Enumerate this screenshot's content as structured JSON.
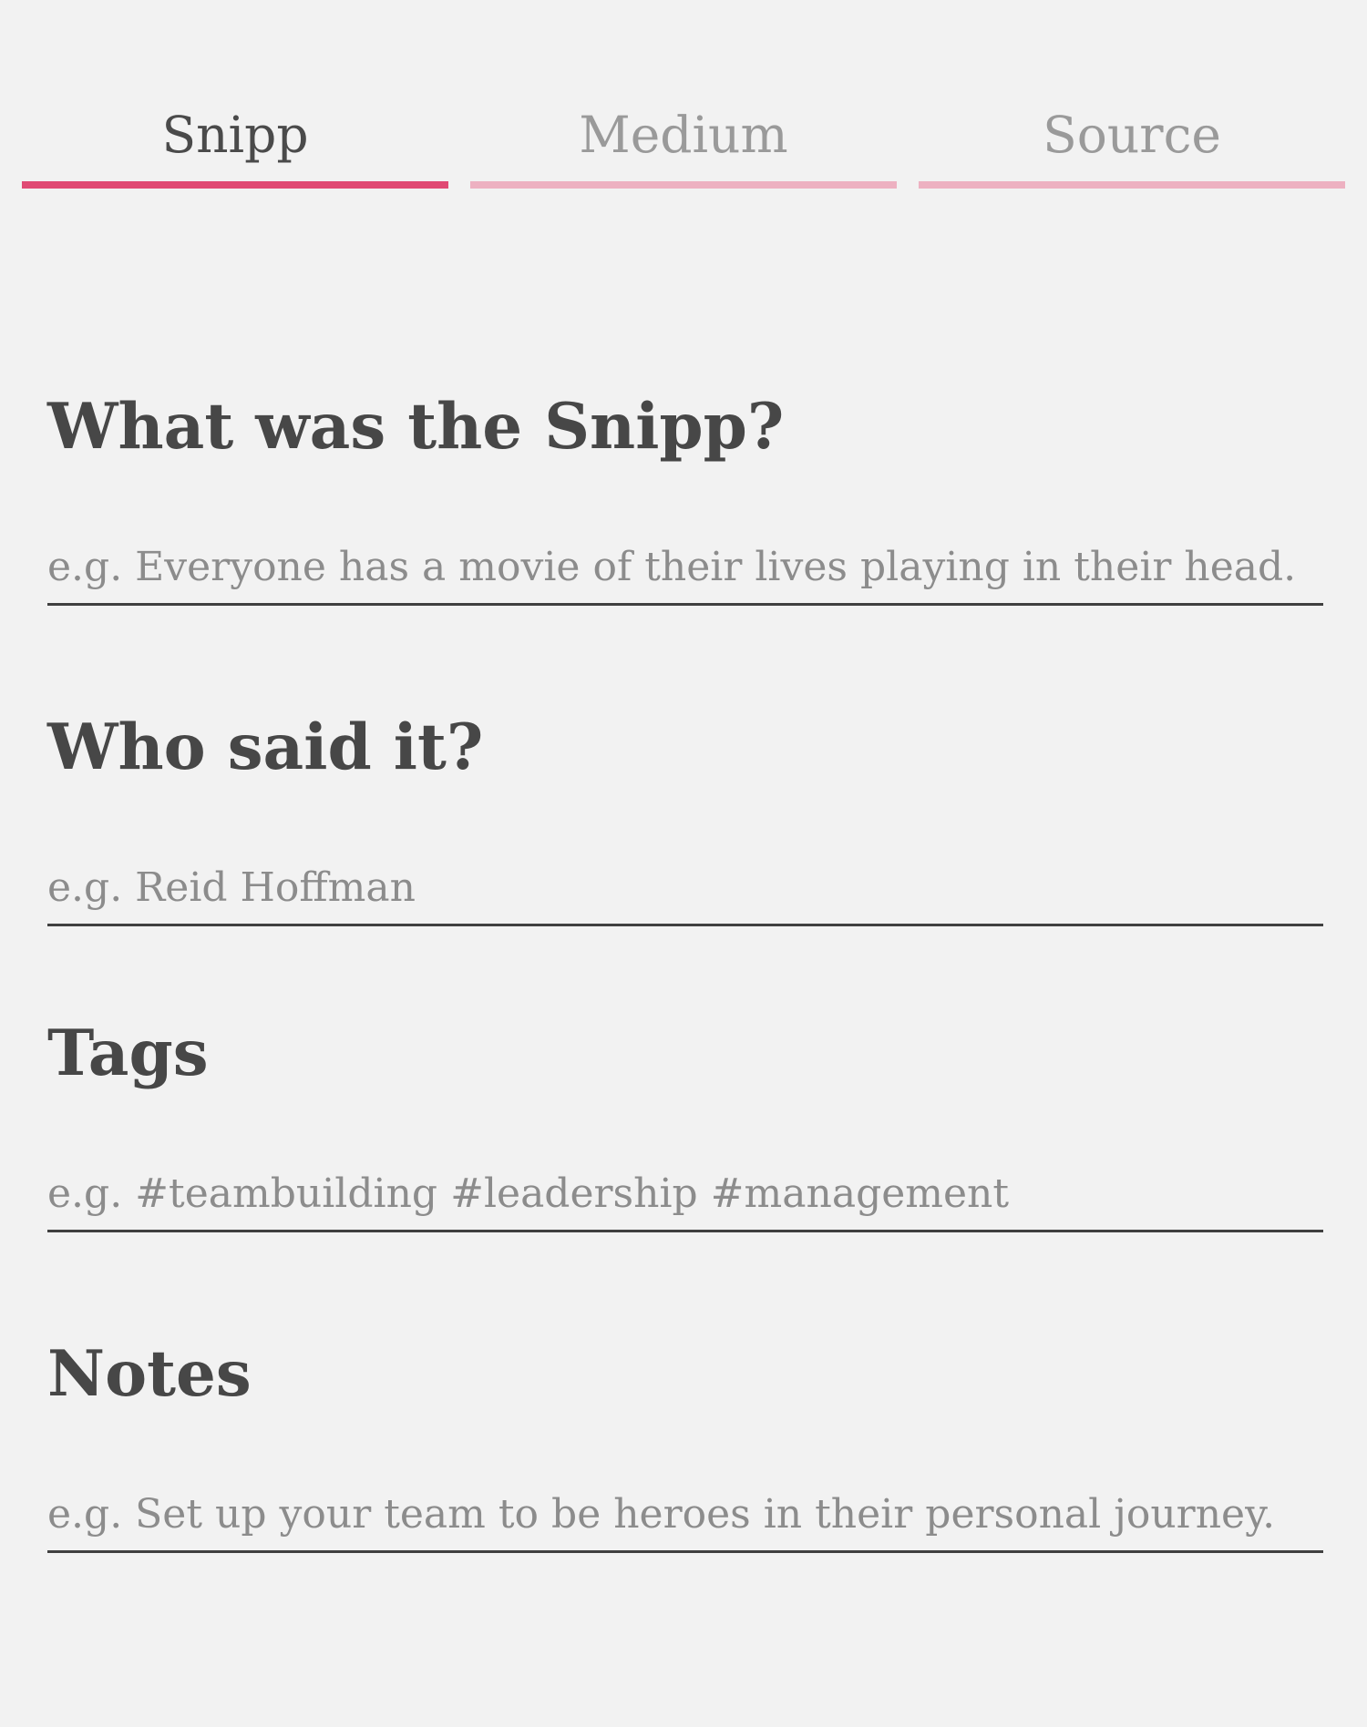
{
  "tabs": [
    {
      "label": "Snipp",
      "active": true
    },
    {
      "label": "Medium",
      "active": false
    },
    {
      "label": "Source",
      "active": false
    }
  ],
  "fields": [
    {
      "label": "What was the Snipp?",
      "placeholder": "e.g. Everyone has a movie of their lives playing in their head.",
      "value": ""
    },
    {
      "label": "Who said it?",
      "placeholder": "e.g. Reid Hoffman",
      "value": ""
    },
    {
      "label": "Tags",
      "placeholder": "e.g. #teambuilding #leadership #management",
      "value": ""
    },
    {
      "label": "Notes",
      "placeholder": "e.g. Set up your team to be heroes in their personal journey.",
      "value": ""
    }
  ],
  "colors": {
    "background": "#f2f2f2",
    "accent": "#e04a74",
    "accent_light": "#edb1c1",
    "text": "#474747",
    "placeholder": "#8c8c8c"
  }
}
